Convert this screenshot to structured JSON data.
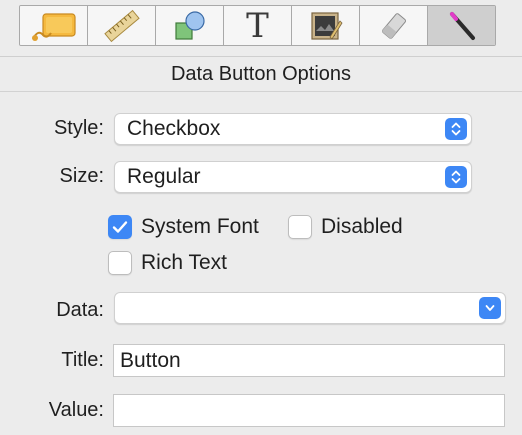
{
  "toolbar": {
    "tools": [
      {
        "icon": "tag-icon",
        "selected": false
      },
      {
        "icon": "ruler-icon",
        "selected": false
      },
      {
        "icon": "shapes-icon",
        "selected": false
      },
      {
        "icon": "text-icon",
        "glyph": "T",
        "selected": false
      },
      {
        "icon": "picture-frame-icon",
        "selected": false
      },
      {
        "icon": "eraser-icon",
        "selected": false
      },
      {
        "icon": "magic-wand-icon",
        "selected": true
      }
    ]
  },
  "panel": {
    "title": "Data Button Options"
  },
  "form": {
    "style": {
      "label": "Style:",
      "value": "Checkbox"
    },
    "size": {
      "label": "Size:",
      "value": "Regular"
    },
    "system_font": {
      "label": "System Font",
      "checked": true
    },
    "disabled": {
      "label": "Disabled",
      "checked": false
    },
    "rich_text": {
      "label": "Rich Text",
      "checked": false
    },
    "data": {
      "label": "Data:",
      "value": ""
    },
    "title": {
      "label": "Title:",
      "value": "Button"
    },
    "value": {
      "label": "Value:",
      "value": ""
    }
  },
  "colors": {
    "accent": "#3d87f5",
    "background": "#ececec"
  }
}
